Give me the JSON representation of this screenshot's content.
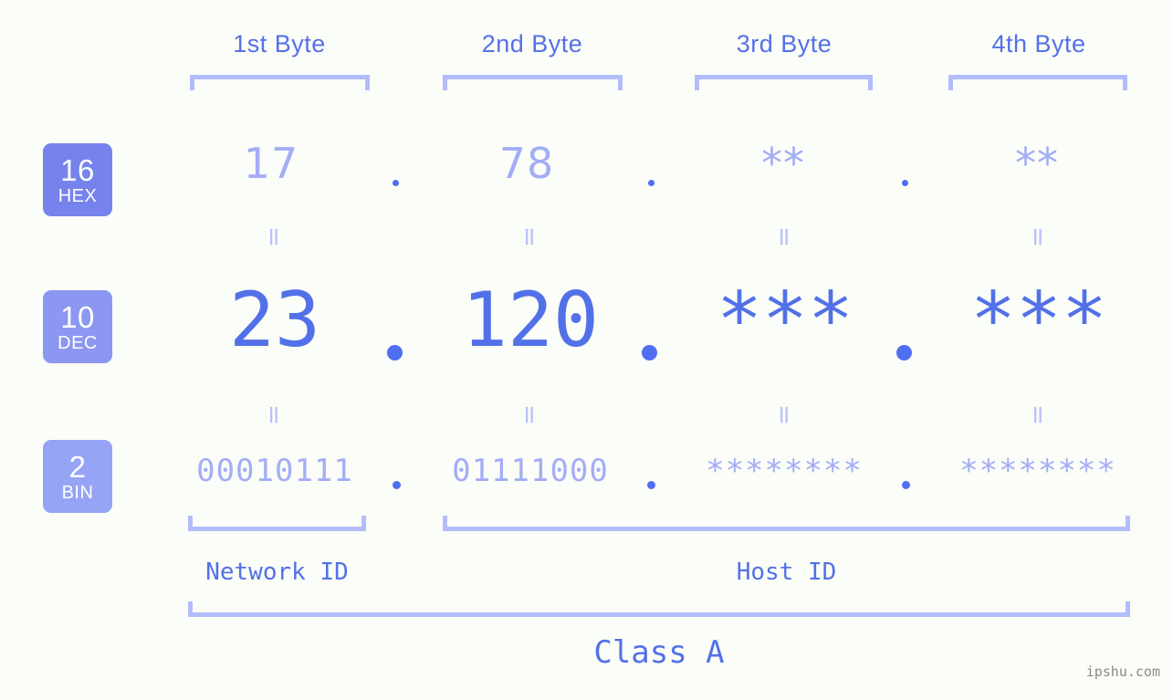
{
  "background_color": "#fbfdf8",
  "accent_strong": "#5271e8",
  "accent_light": "#a3adf7",
  "bracket_color": "#b3bcfa",
  "headers": [
    {
      "label": "1st Byte"
    },
    {
      "label": "2nd Byte"
    },
    {
      "label": "3rd Byte"
    },
    {
      "label": "4th Byte"
    }
  ],
  "bases": [
    {
      "number": "16",
      "name": "HEX",
      "color": "#7683ec"
    },
    {
      "number": "10",
      "name": "DEC",
      "color": "#8b97f0"
    },
    {
      "number": "2",
      "name": "BIN",
      "color": "#96a4f5"
    }
  ],
  "rows": {
    "hex": {
      "values": [
        "17",
        "78",
        "**",
        "**"
      ]
    },
    "dec": {
      "values": [
        "23",
        "120",
        "***",
        "***"
      ]
    },
    "bin": {
      "values": [
        "00010111",
        "01111000",
        "********",
        "********"
      ]
    }
  },
  "separators": {
    "hex": [
      ".",
      ".",
      "."
    ],
    "dec": [
      ".",
      ".",
      "."
    ],
    "bin": [
      ".",
      ".",
      "."
    ]
  },
  "equals_sign": "=",
  "segments": {
    "network_id": "Network ID",
    "host_id": "Host ID",
    "class": "Class A"
  },
  "watermark": "ipshu.com"
}
